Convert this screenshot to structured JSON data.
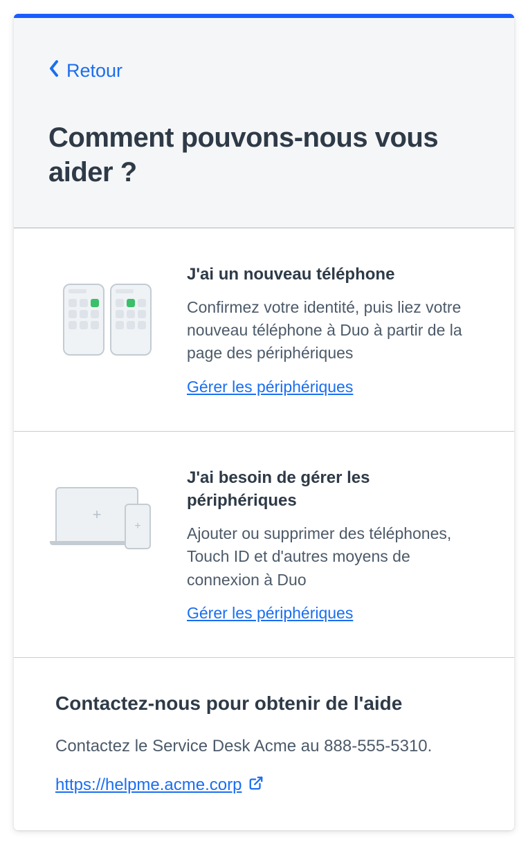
{
  "back_label": "Retour",
  "title": "Comment pouvons-nous vous aider ?",
  "options": [
    {
      "title": "J'ai un nouveau téléphone",
      "desc": "Confirmez votre identité, puis liez votre nouveau téléphone à Duo à partir de la page des périphériques",
      "link": "Gérer les périphériques"
    },
    {
      "title": "J'ai besoin de gérer les périphériques",
      "desc": "Ajouter ou supprimer des téléphones, Touch ID et d'autres moyens de connexion à Duo",
      "link": "Gérer les périphériques"
    }
  ],
  "contact": {
    "title": "Contactez-nous pour obtenir de l'aide",
    "text": "Contactez le Service Desk Acme au 888-555-5310.",
    "link": "https://helpme.acme.corp"
  }
}
